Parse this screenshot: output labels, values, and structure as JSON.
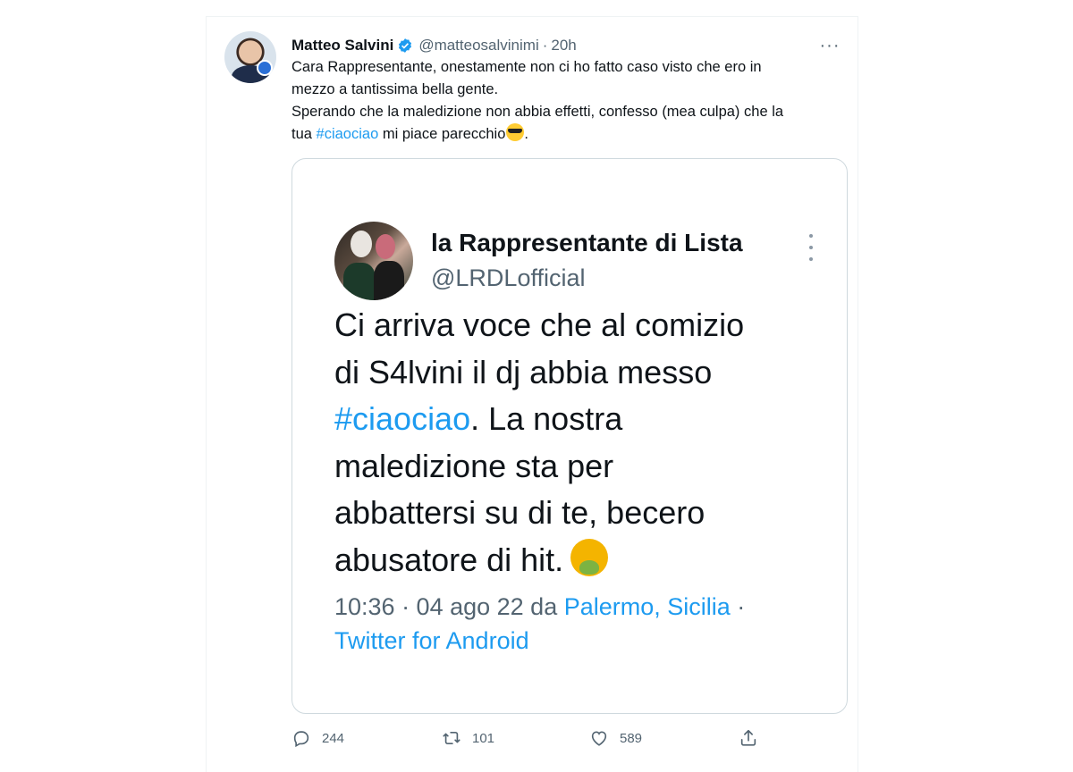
{
  "tweet": {
    "author_name": "Matteo Salvini",
    "handle": "@matteosalvinimi",
    "separator": "·",
    "time": "20h",
    "more_label": "···",
    "text_line1": "Cara Rappresentante, onestamente non ci ho fatto caso visto che ero in",
    "text_line2": "mezzo a tantissima bella gente.",
    "text_line3": "Sperando che la maledizione non abbia effetti, confesso (mea culpa) che la",
    "text_line4_pre": "tua ",
    "text_hashtag": "#ciaociao",
    "text_line4_post": " mi piace parecchio",
    "text_end": ".",
    "emoji": "sunglasses-emoji"
  },
  "quoted": {
    "author_name": "la Rappresentante di Lista",
    "handle": "@LRDLofficial",
    "line1": "Ci arriva voce che al comizio",
    "line2": "di S4lvini il dj abbia messo",
    "hashtag": "#ciaociao",
    "line3_post": ". La nostra",
    "line4": "maledizione sta per",
    "line5": "abbattersi su di te, becero",
    "line6": "abusatore di hit.",
    "emoji": "nauseated-face-emoji",
    "meta_time": "10:36 · 04 ago 22 da ",
    "meta_location": "Palermo, Sicilia",
    "meta_sep": " ·",
    "meta_source": "Twitter for Android"
  },
  "actions": {
    "replies": "244",
    "retweets": "101",
    "likes": "589"
  },
  "colors": {
    "link": "#1d9bf0",
    "text": "#0f1419",
    "muted": "#536471",
    "verified": "#1d9bf0"
  }
}
